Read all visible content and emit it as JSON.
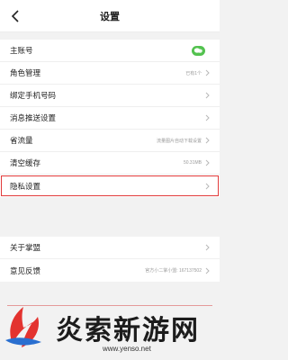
{
  "header": {
    "title": "设置",
    "back_icon": "chevron-left-icon"
  },
  "group1": [
    {
      "key": "main-account",
      "label": "主账号",
      "value": "",
      "icon": "wechat-icon"
    },
    {
      "key": "role-manage",
      "label": "角色管理",
      "value": "已有1个"
    },
    {
      "key": "bind-phone",
      "label": "绑定手机号码",
      "value": ""
    },
    {
      "key": "push-settings",
      "label": "消息推送设置",
      "value": ""
    },
    {
      "key": "save-data",
      "label": "省流量",
      "value": "流量图片自动下载设置"
    },
    {
      "key": "clear-cache",
      "label": "清空缓存",
      "value": "50.31MB"
    },
    {
      "key": "privacy",
      "label": "隐私设置",
      "value": ""
    }
  ],
  "group2": [
    {
      "key": "about",
      "label": "关于掌盟",
      "value": ""
    },
    {
      "key": "feedback",
      "label": "意见反馈",
      "value": "官方小二掌小盟: 167137502"
    }
  ],
  "watermark": {
    "name": "炎索新游网",
    "url": "www.yenso.net"
  },
  "colors": {
    "accent": "#e23b3b",
    "wechat": "#53c24f"
  }
}
